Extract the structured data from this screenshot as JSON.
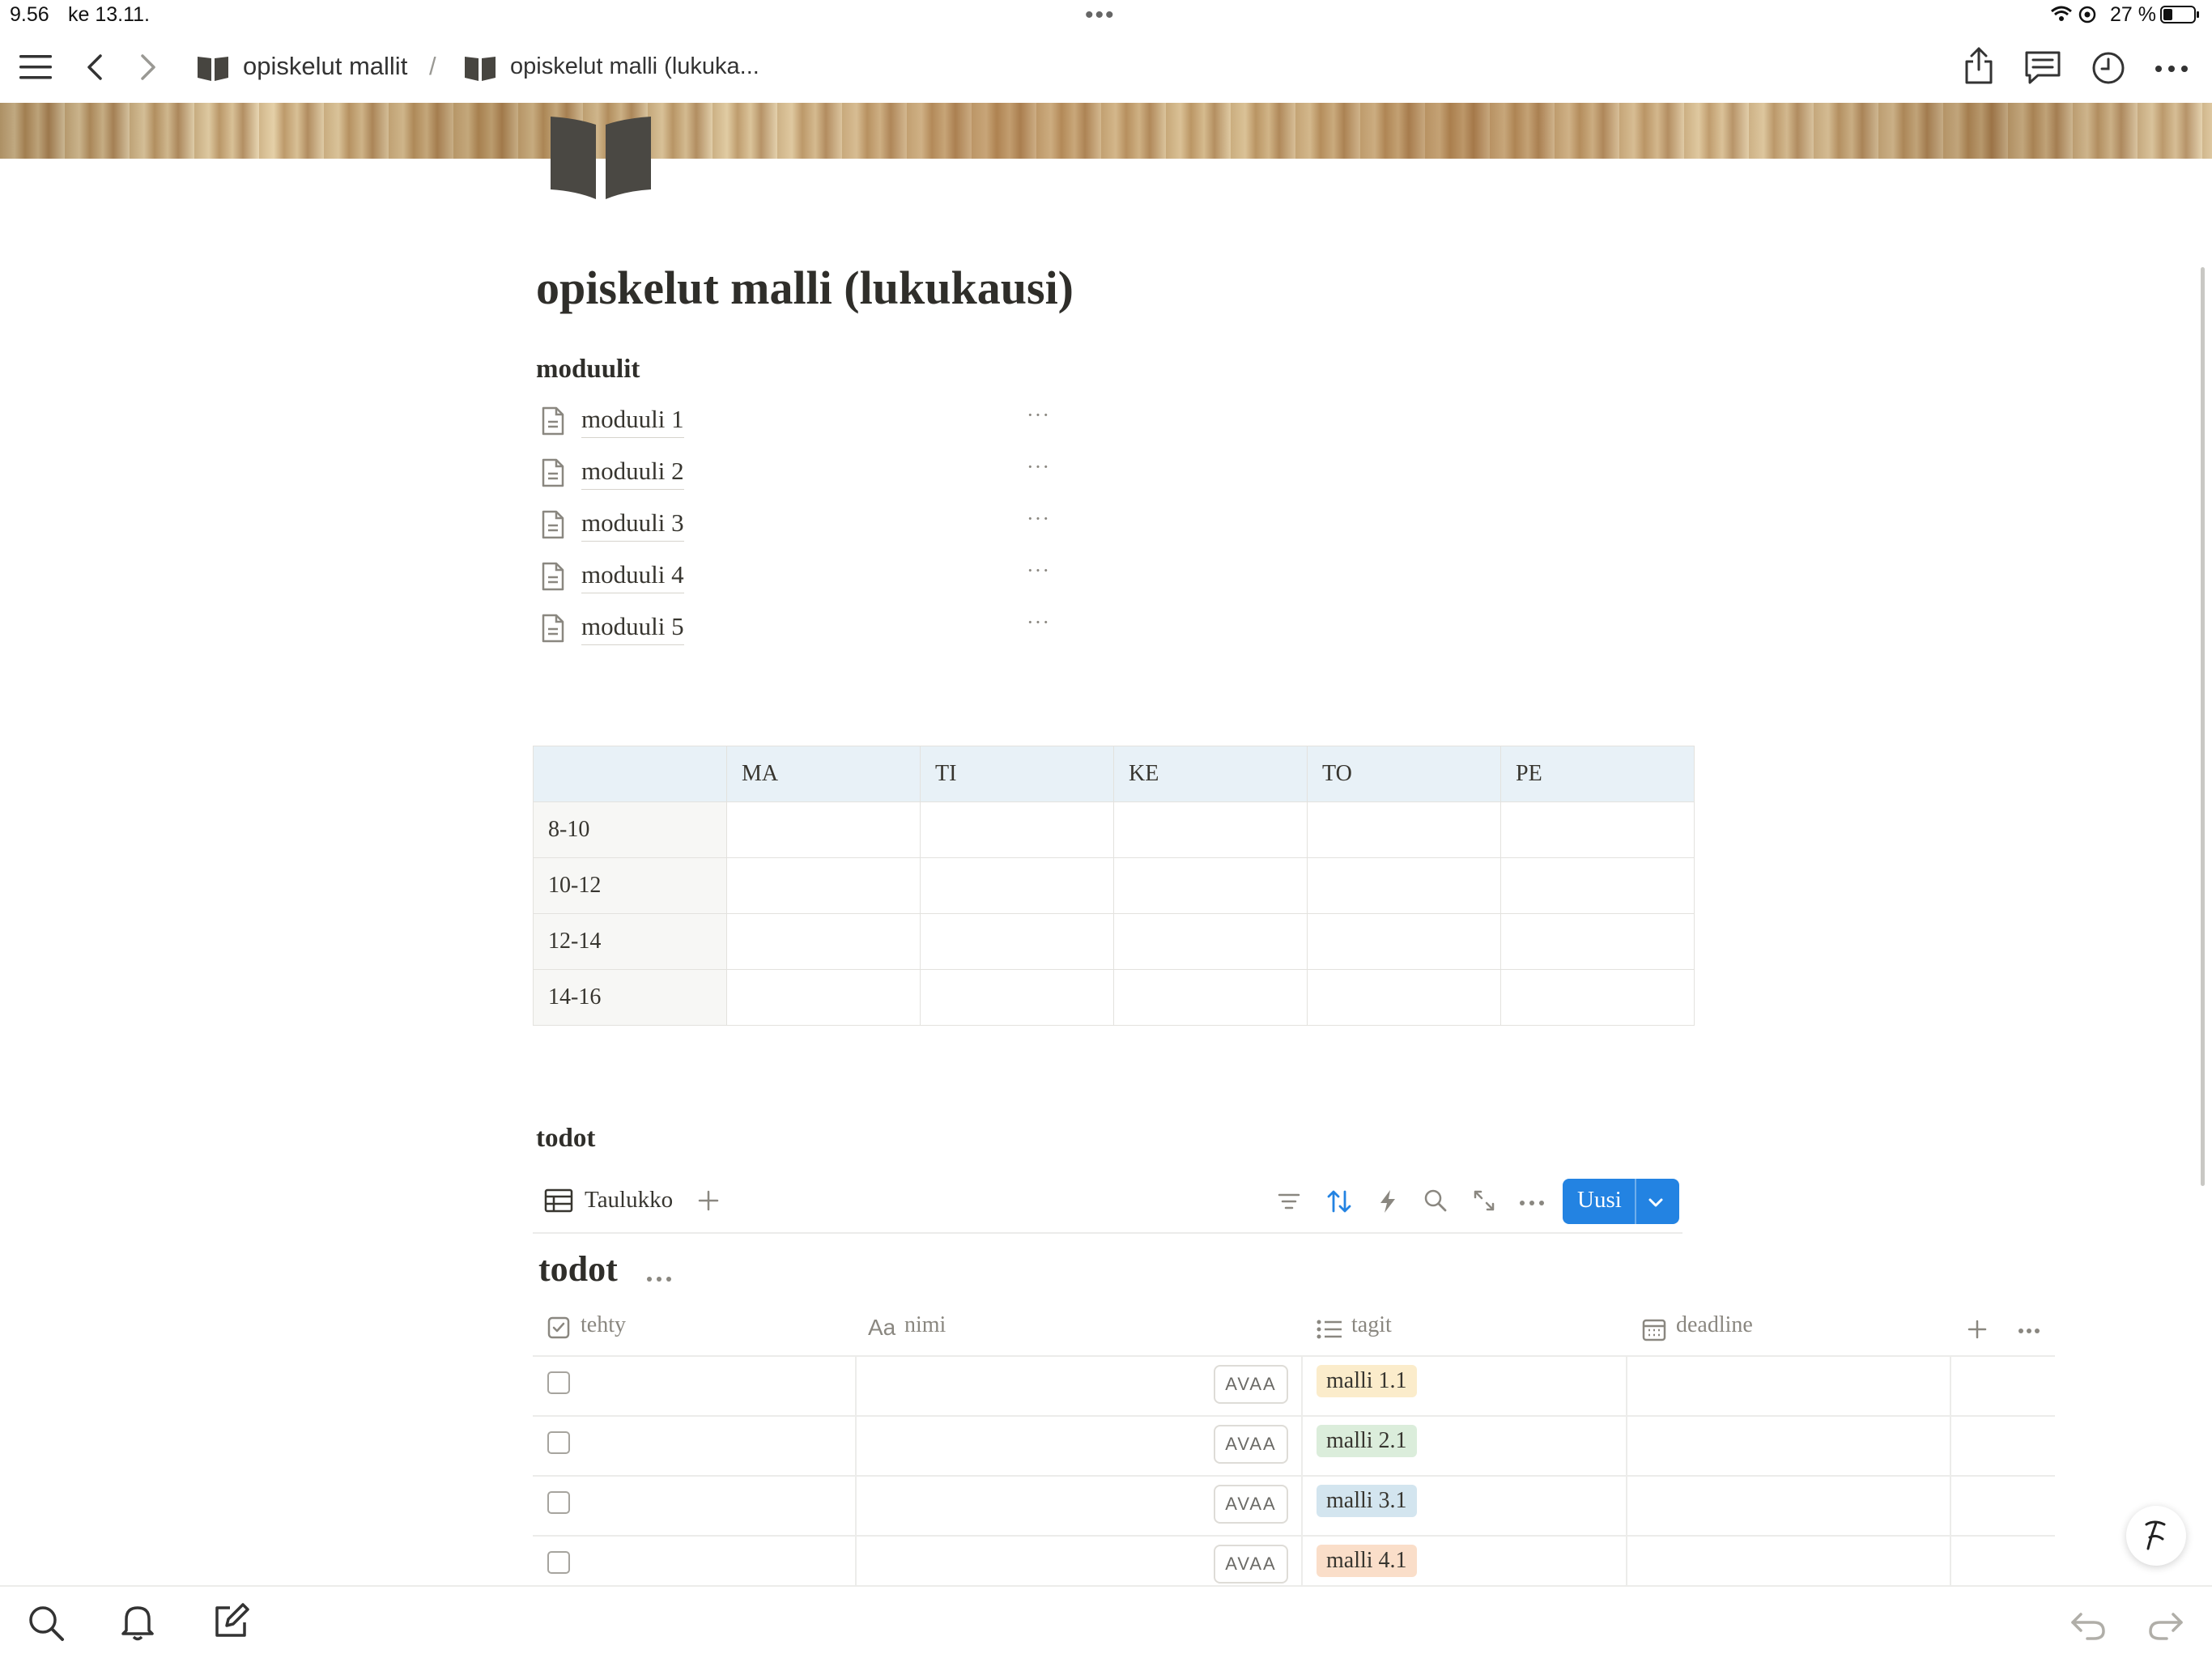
{
  "status_bar": {
    "time": "9.56",
    "date": "ke 13.11.",
    "battery": "27 %"
  },
  "nav": {
    "breadcrumb": [
      {
        "label": "opiskelut mallit"
      },
      {
        "separator": "/"
      },
      {
        "label": "opiskelut malli (lukuka..."
      }
    ]
  },
  "page": {
    "title": "opiskelut malli (lukukausi)",
    "modules_heading": "moduulit",
    "modules": [
      {
        "label": "moduuli 1"
      },
      {
        "label": "moduuli 2"
      },
      {
        "label": "moduuli 3"
      },
      {
        "label": "moduuli 4"
      },
      {
        "label": "moduuli 5"
      }
    ],
    "more_glyph": "···"
  },
  "schedule": {
    "headers": [
      "",
      "MA",
      "TI",
      "KE",
      "TO",
      "PE"
    ],
    "rows": [
      {
        "time": "8-10"
      },
      {
        "time": "10-12"
      },
      {
        "time": "12-14"
      },
      {
        "time": "14-16"
      }
    ]
  },
  "todos": {
    "section_heading": "todot",
    "view_tab": "Taulukko",
    "new_button": "Uusi",
    "db_title": "todot",
    "columns": {
      "done": "tehty",
      "name_prefix": "Aa",
      "name": "nimi",
      "tags": "tagit",
      "deadline": "deadline"
    },
    "open_label": "AVAA",
    "rows": [
      {
        "tag": "malli 1.1",
        "tag_color": "#fbeccb"
      },
      {
        "tag": "malli 2.1",
        "tag_color": "#dbeddb"
      },
      {
        "tag": "malli 3.1",
        "tag_color": "#d3e5ef"
      },
      {
        "tag": "malli 4.1",
        "tag_color": "#fadec9"
      }
    ]
  },
  "colors": {
    "accent": "#2383e2",
    "text": "#37352f",
    "muted": "#8a8780"
  }
}
